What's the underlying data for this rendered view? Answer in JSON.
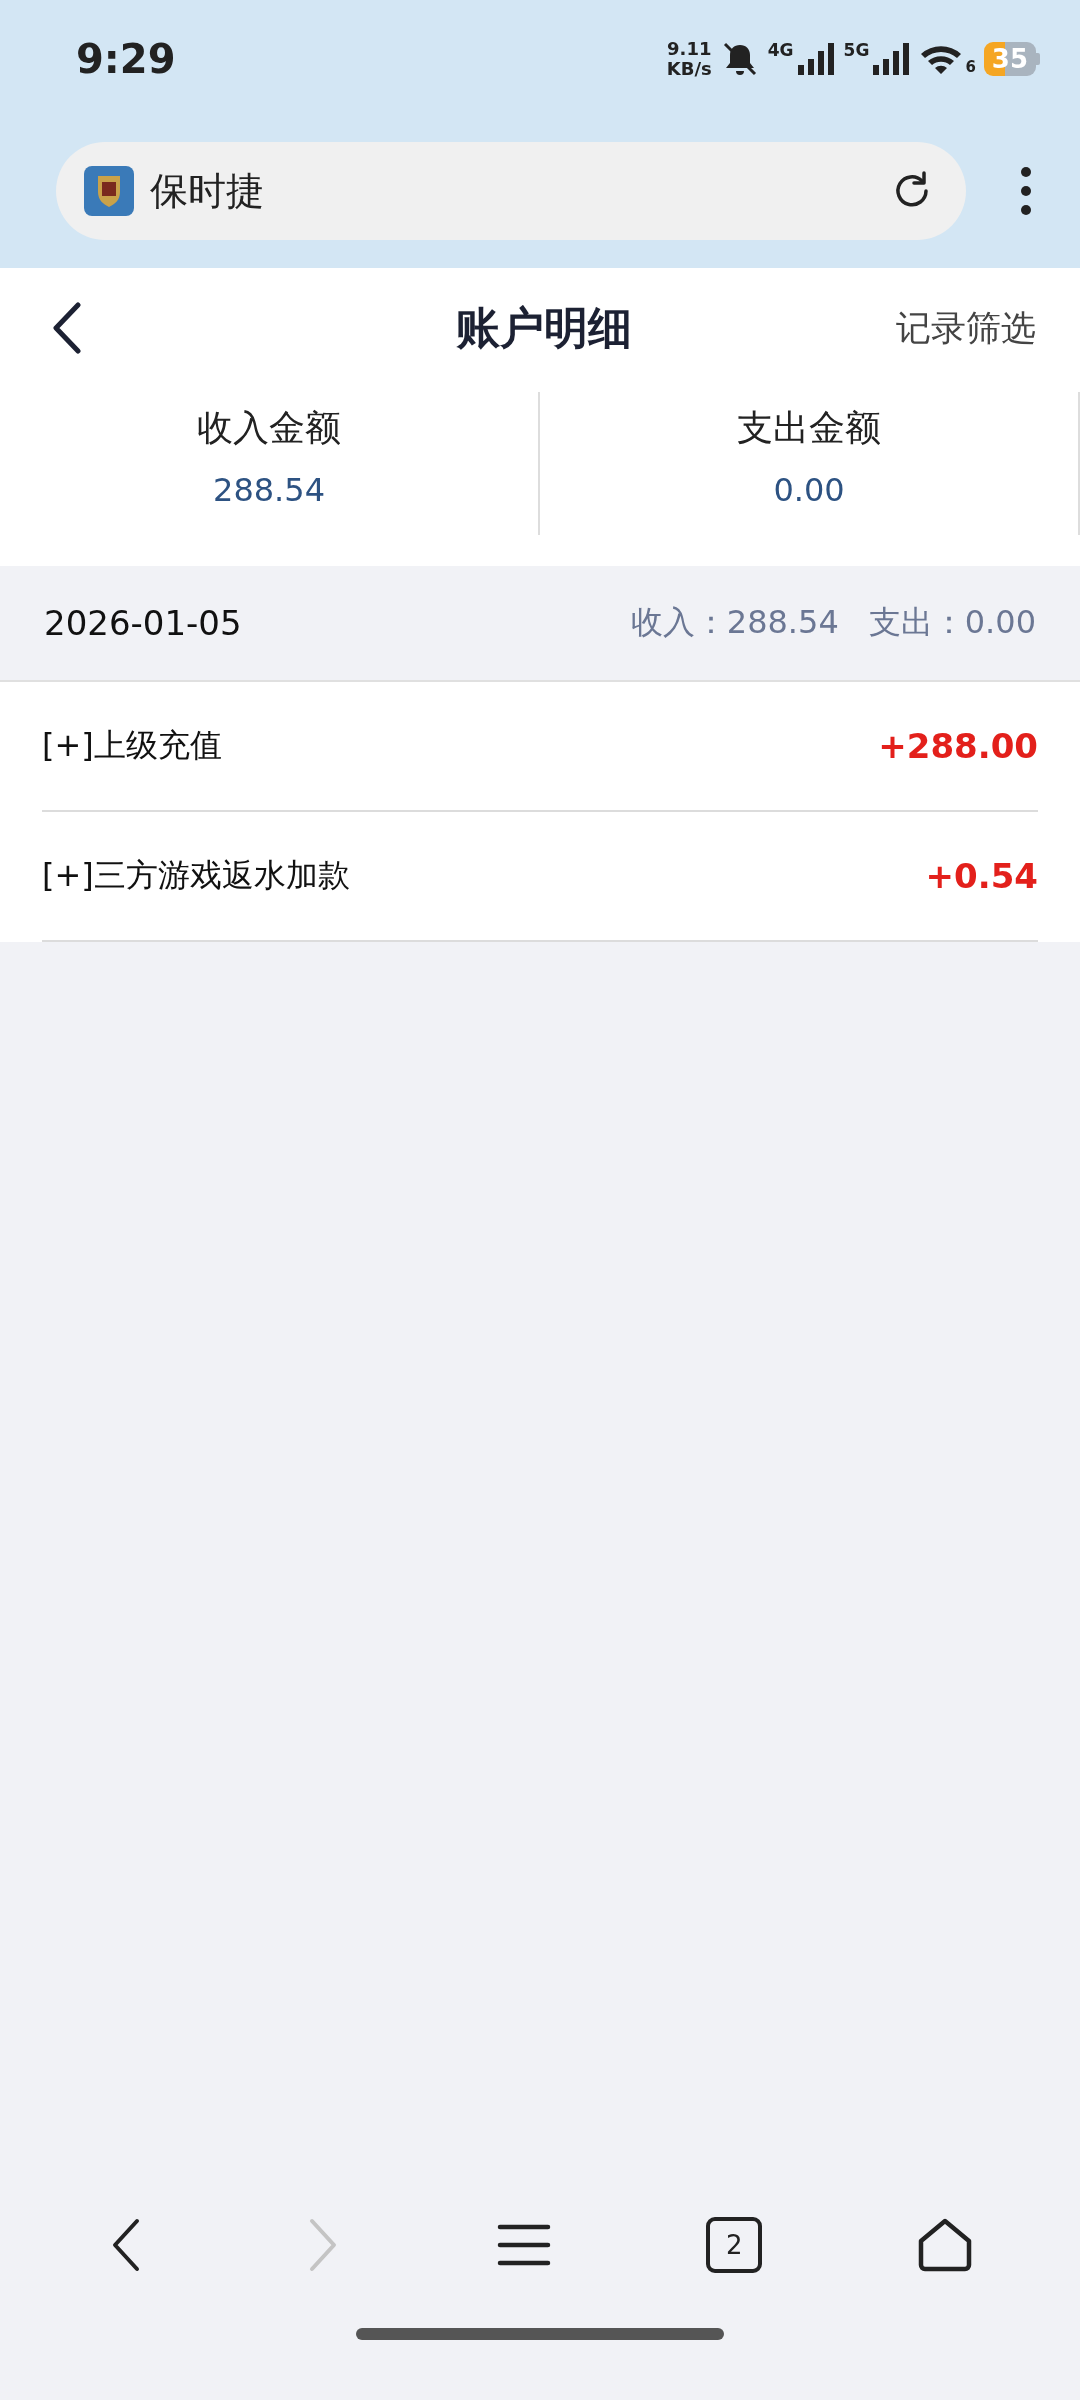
{
  "status_bar": {
    "time": "9:29",
    "net_speed": "9.11",
    "net_unit": "KB/s",
    "mobile_1": "4G",
    "mobile_2": "5G",
    "wifi_badge": "6",
    "battery": "35"
  },
  "browser": {
    "site_title": "保时捷"
  },
  "header": {
    "title": "账户明细",
    "action": "记录筛选"
  },
  "summary": [
    {
      "label": "收入金额",
      "value": "288.54"
    },
    {
      "label": "支出金额",
      "value": "0.00"
    }
  ],
  "day": {
    "date": "2026-01-05",
    "income_label": "收入：",
    "income": "288.54",
    "expense_label": "支出：",
    "expense": "0.00"
  },
  "records": [
    {
      "label": "[+]上级充值",
      "amount": "+288.00"
    },
    {
      "label": "[+]三方游戏返水加款",
      "amount": "+0.54"
    }
  ],
  "nav": {
    "back_disabled": false,
    "forward_disabled": true,
    "tab_count": "2"
  }
}
